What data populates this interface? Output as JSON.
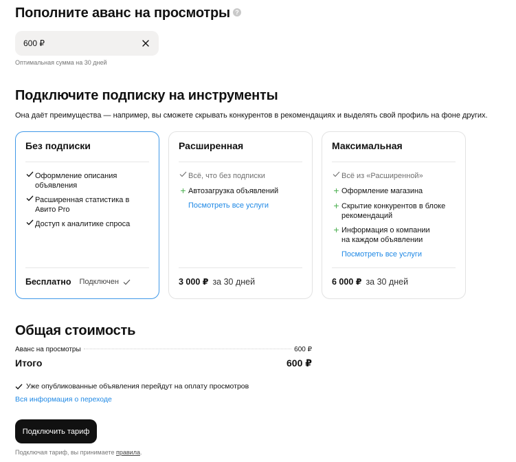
{
  "advance": {
    "title": "Пополните аванс на просмотры",
    "help_glyph": "?",
    "amount_value": "600 ₽",
    "hint": "Оптимальная сумма на 30 дней"
  },
  "subscription": {
    "title": "Подключите подписку на инструменты",
    "description": "Она даёт преимущества — например, вы сможете скрывать конкурентов в рекомендациях и выделять свой профиль на фоне других.",
    "plans": [
      {
        "name": "Без подписки",
        "selected": true,
        "features": [
          {
            "icon": "check",
            "text": "Оформление описания объявления"
          },
          {
            "icon": "check",
            "text": "Расширенная статистика в Авито Pro"
          },
          {
            "icon": "check",
            "text": "Доступ к аналитике спроса"
          }
        ],
        "price": "Бесплатно",
        "status": "Подключен"
      },
      {
        "name": "Расширенная",
        "selected": false,
        "features": [
          {
            "icon": "check-muted",
            "text": "Всё, что без подписки"
          },
          {
            "icon": "plus",
            "text": "Автозагрузка объявлений"
          }
        ],
        "link": "Посмотреть все услуги",
        "price": "3 000 ₽",
        "period": "за 30 дней"
      },
      {
        "name": "Максимальная",
        "selected": false,
        "features": [
          {
            "icon": "check-muted",
            "text": "Всё из «Расширенной»"
          },
          {
            "icon": "plus",
            "text": "Оформление магазина"
          },
          {
            "icon": "plus",
            "text": "Скрытие конкурентов в блоке рекомендаций"
          },
          {
            "icon": "plus",
            "text": "Информация о компании на каждом объявлении"
          }
        ],
        "link": "Посмотреть все услуги",
        "price": "6 000 ₽",
        "period": "за 30 дней"
      }
    ]
  },
  "total": {
    "title": "Общая стоимость",
    "line_label": "Аванс на просмотры",
    "line_value": "600 ₽",
    "total_label": "Итого",
    "total_value": "600 ₽",
    "note": "Уже опубликованные объявления перейдут на оплату просмотров",
    "info_link": "Вся информация о переходе"
  },
  "cta": {
    "label": "Подключить тариф",
    "terms_prefix": "Подключая тариф, вы принимаете",
    "terms_link": "правила",
    "terms_suffix": "."
  },
  "colors": {
    "accent_link": "#1e88e5",
    "selected_border": "#3e98e8",
    "plus_green": "#4caf50",
    "button_bg": "#111111"
  }
}
